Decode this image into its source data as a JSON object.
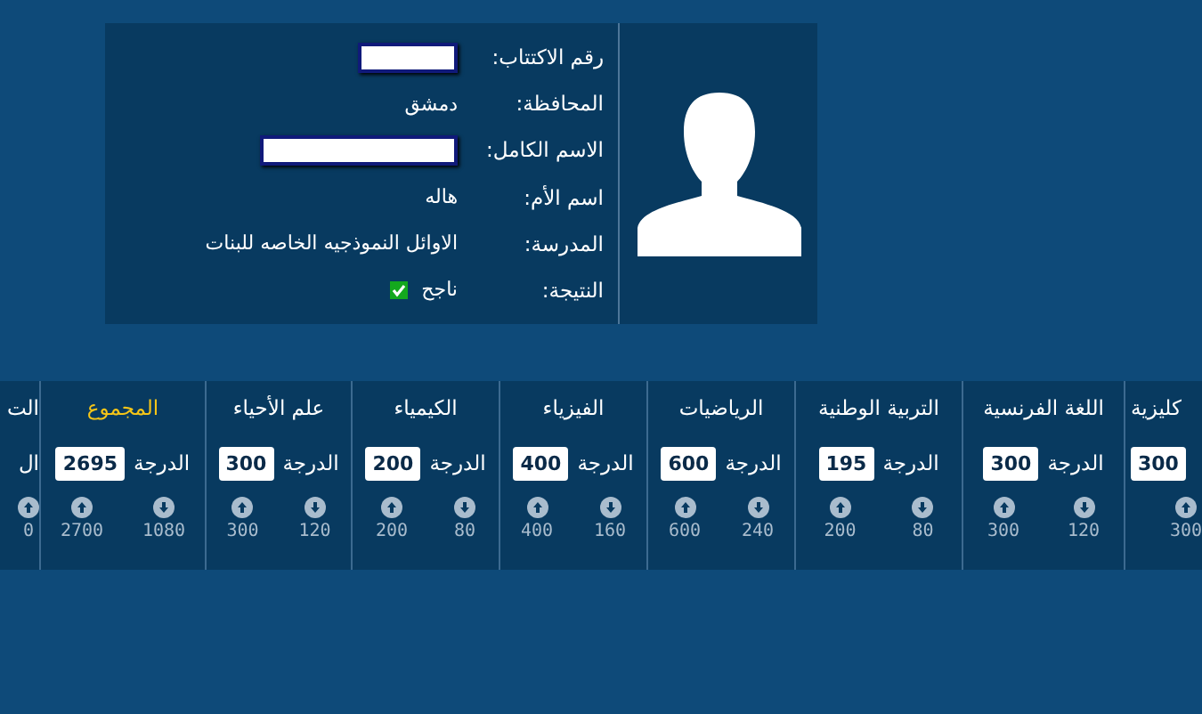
{
  "student": {
    "rows": [
      {
        "label": "رقم الاكتتاب:",
        "kind": "field"
      },
      {
        "label": "المحافظة:",
        "kind": "text",
        "value": "دمشق"
      },
      {
        "label": "الاسم الكامل:",
        "kind": "field"
      },
      {
        "label": "اسم الأم:",
        "kind": "text",
        "value": "هاله"
      },
      {
        "label": "المدرسة:",
        "kind": "text",
        "value": "الاوائل النموذجيه الخاصه للبنات"
      },
      {
        "label": "النتيجة:",
        "kind": "result",
        "value": "ناجح",
        "checked": true
      }
    ]
  },
  "subjects": [
    {
      "title": "كليزية",
      "total": false,
      "grade": "300",
      "stats": [
        {
          "kind": "up",
          "value": "300"
        }
      ]
    },
    {
      "title": "اللغة الفرنسية",
      "total": false,
      "grade_label": "الدرجة",
      "grade": "300",
      "stats": [
        {
          "kind": "down",
          "value": "120"
        },
        {
          "kind": "up",
          "value": "300"
        }
      ]
    },
    {
      "title": "التربية الوطنية",
      "total": false,
      "grade_label": "الدرجة",
      "grade": "195",
      "stats": [
        {
          "kind": "down",
          "value": "80"
        },
        {
          "kind": "up",
          "value": "200"
        }
      ]
    },
    {
      "title": "الرياضيات",
      "total": false,
      "grade_label": "الدرجة",
      "grade": "600",
      "stats": [
        {
          "kind": "down",
          "value": "240"
        },
        {
          "kind": "up",
          "value": "600"
        }
      ]
    },
    {
      "title": "الفيزياء",
      "total": false,
      "grade_label": "الدرجة",
      "grade": "400",
      "stats": [
        {
          "kind": "down",
          "value": "160"
        },
        {
          "kind": "up",
          "value": "400"
        }
      ]
    },
    {
      "title": "الكيمياء",
      "total": false,
      "grade_label": "الدرجة",
      "grade": "200",
      "stats": [
        {
          "kind": "down",
          "value": "80"
        },
        {
          "kind": "up",
          "value": "200"
        }
      ]
    },
    {
      "title": "علم الأحياء",
      "total": false,
      "grade_label": "الدرجة",
      "grade": "300",
      "stats": [
        {
          "kind": "down",
          "value": "120"
        },
        {
          "kind": "up",
          "value": "300"
        }
      ]
    },
    {
      "title": "المجموع",
      "total": true,
      "grade_label": "الدرجة",
      "grade": "2695",
      "stats": [
        {
          "kind": "down",
          "value": "1080"
        },
        {
          "kind": "up",
          "value": "2700"
        }
      ]
    },
    {
      "title": "الت",
      "total": false,
      "grade_label": "ال",
      "stats": [
        {
          "kind": "up",
          "value": "0"
        }
      ]
    }
  ]
}
